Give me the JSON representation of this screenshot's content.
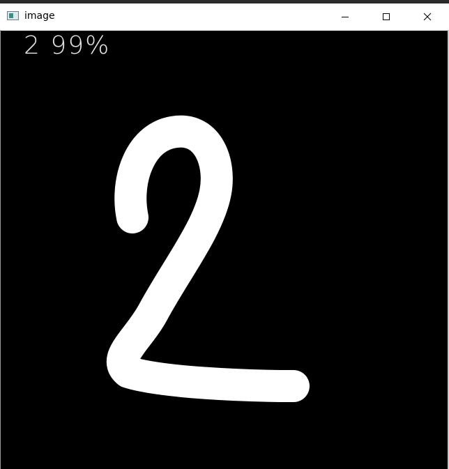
{
  "window": {
    "title": "image",
    "icon": "image-window-icon",
    "controls": {
      "minimize_icon": "minimize-icon",
      "maximize_icon": "maximize-icon",
      "close_icon": "close-icon"
    }
  },
  "canvas": {
    "background": "#000000",
    "prediction": {
      "digit": "2",
      "confidence": "99%",
      "text": "2 99%",
      "color": "#e4e4e4"
    },
    "drawing": {
      "stroke_color": "#ffffff",
      "depicts": "handwritten-digit-2"
    }
  }
}
